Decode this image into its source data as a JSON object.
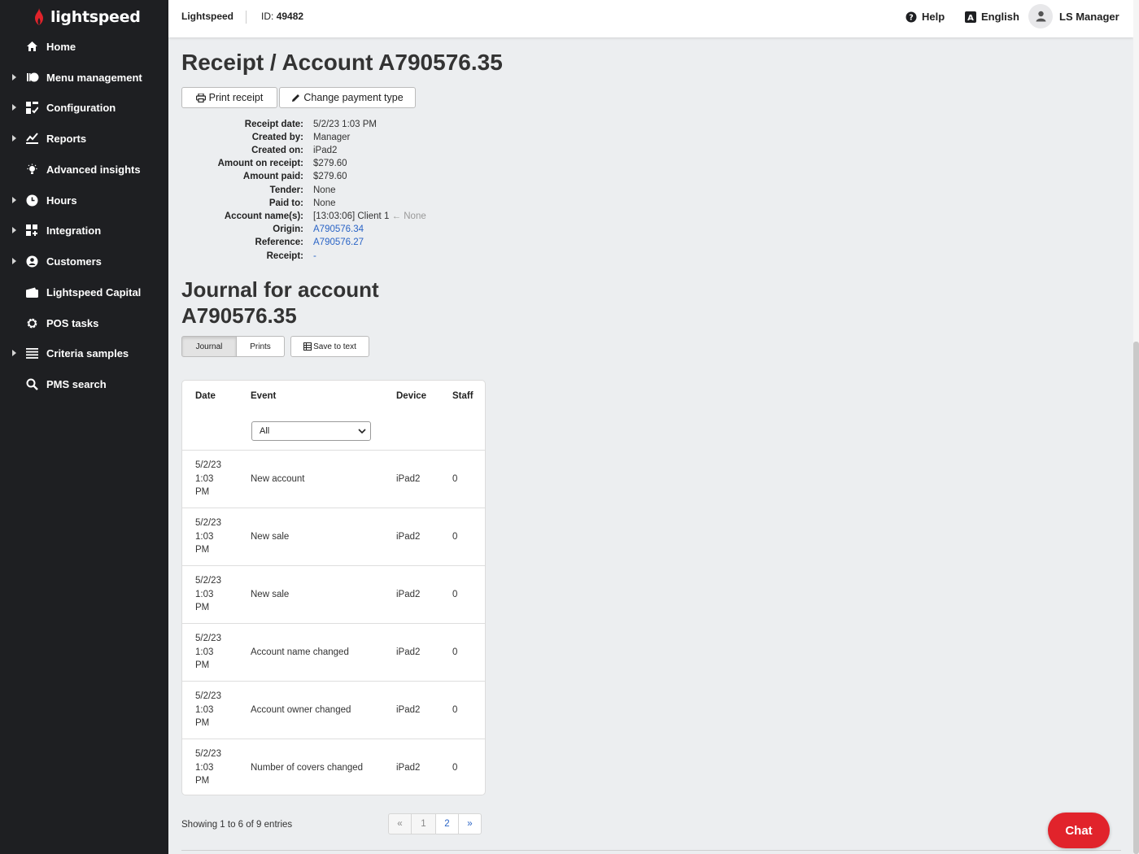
{
  "app": {
    "brand": "lightspeed",
    "colors": {
      "sidebar": "#1e1f22",
      "accent": "#e1232b",
      "link": "#2a64c6"
    }
  },
  "sidebar": {
    "items": [
      {
        "label": "Home",
        "icon": "home-icon",
        "expandable": false
      },
      {
        "label": "Menu management",
        "icon": "menu-management-icon",
        "expandable": true
      },
      {
        "label": "Configuration",
        "icon": "configuration-icon",
        "expandable": true
      },
      {
        "label": "Reports",
        "icon": "reports-chart-icon",
        "expandable": true
      },
      {
        "label": "Advanced insights",
        "icon": "lightbulb-icon",
        "expandable": false
      },
      {
        "label": "Hours",
        "icon": "clock-icon",
        "expandable": true
      },
      {
        "label": "Integration",
        "icon": "integration-grid-icon",
        "expandable": true
      },
      {
        "label": "Customers",
        "icon": "customer-icon",
        "expandable": true
      },
      {
        "label": "Lightspeed Capital",
        "icon": "wallet-icon",
        "expandable": false
      },
      {
        "label": "POS tasks",
        "icon": "gear-icon",
        "expandable": false
      },
      {
        "label": "Criteria samples",
        "icon": "list-icon",
        "expandable": true
      },
      {
        "label": "PMS search",
        "icon": "search-icon",
        "expandable": false
      }
    ]
  },
  "topbar": {
    "brand": "Lightspeed",
    "id_label": "ID:",
    "id_value": "49482",
    "help": "Help",
    "language": "English",
    "user": "LS Manager"
  },
  "receipt": {
    "title": "Receipt / Account A790576.35",
    "print_button": "Print receipt",
    "change_payment_button": "Change payment type",
    "details": [
      {
        "label": "Receipt date:",
        "value": "5/2/23 1:03 PM"
      },
      {
        "label": "Created by:",
        "value": "Manager"
      },
      {
        "label": "Created on:",
        "value": "iPad2"
      },
      {
        "label": "Amount on receipt:",
        "value": "$279.60"
      },
      {
        "label": "Amount paid:",
        "value": "$279.60"
      },
      {
        "label": "Tender:",
        "value": "None"
      },
      {
        "label": "Paid to:",
        "value": "None"
      },
      {
        "label": "Account name(s):",
        "value": "[13:03:06] Client 1",
        "extra": "← None"
      },
      {
        "label": "Origin:",
        "value": "A790576.34",
        "link": true
      },
      {
        "label": "Reference:",
        "value": "A790576.27",
        "link": true
      },
      {
        "label": "Receipt:",
        "value": "-",
        "link": true
      }
    ]
  },
  "journal": {
    "title_line1": "Journal for account",
    "title_line2": "A790576.35",
    "tabs": [
      "Journal",
      "Prints"
    ],
    "save_button": "Save to text",
    "columns": [
      "Date",
      "Event",
      "Device",
      "Staff"
    ],
    "event_filter": "All",
    "rows": [
      {
        "date": [
          "5/2/23",
          "1:03",
          "PM"
        ],
        "event": "New account",
        "device": "iPad2",
        "staff": "0"
      },
      {
        "date": [
          "5/2/23",
          "1:03",
          "PM"
        ],
        "event": "New sale",
        "device": "iPad2",
        "staff": "0"
      },
      {
        "date": [
          "5/2/23",
          "1:03",
          "PM"
        ],
        "event": "New sale",
        "device": "iPad2",
        "staff": "0"
      },
      {
        "date": [
          "5/2/23",
          "1:03",
          "PM"
        ],
        "event": "Account name changed",
        "device": "iPad2",
        "staff": "0"
      },
      {
        "date": [
          "5/2/23",
          "1:03",
          "PM"
        ],
        "event": "Account owner changed",
        "device": "iPad2",
        "staff": "0"
      },
      {
        "date": [
          "5/2/23",
          "1:03",
          "PM"
        ],
        "event": "Number of covers changed",
        "device": "iPad2",
        "staff": "0"
      }
    ],
    "showing": "Showing 1 to 6 of 9 entries",
    "pager": [
      "«",
      "1",
      "2",
      "»"
    ]
  },
  "chat": {
    "label": "Chat"
  }
}
